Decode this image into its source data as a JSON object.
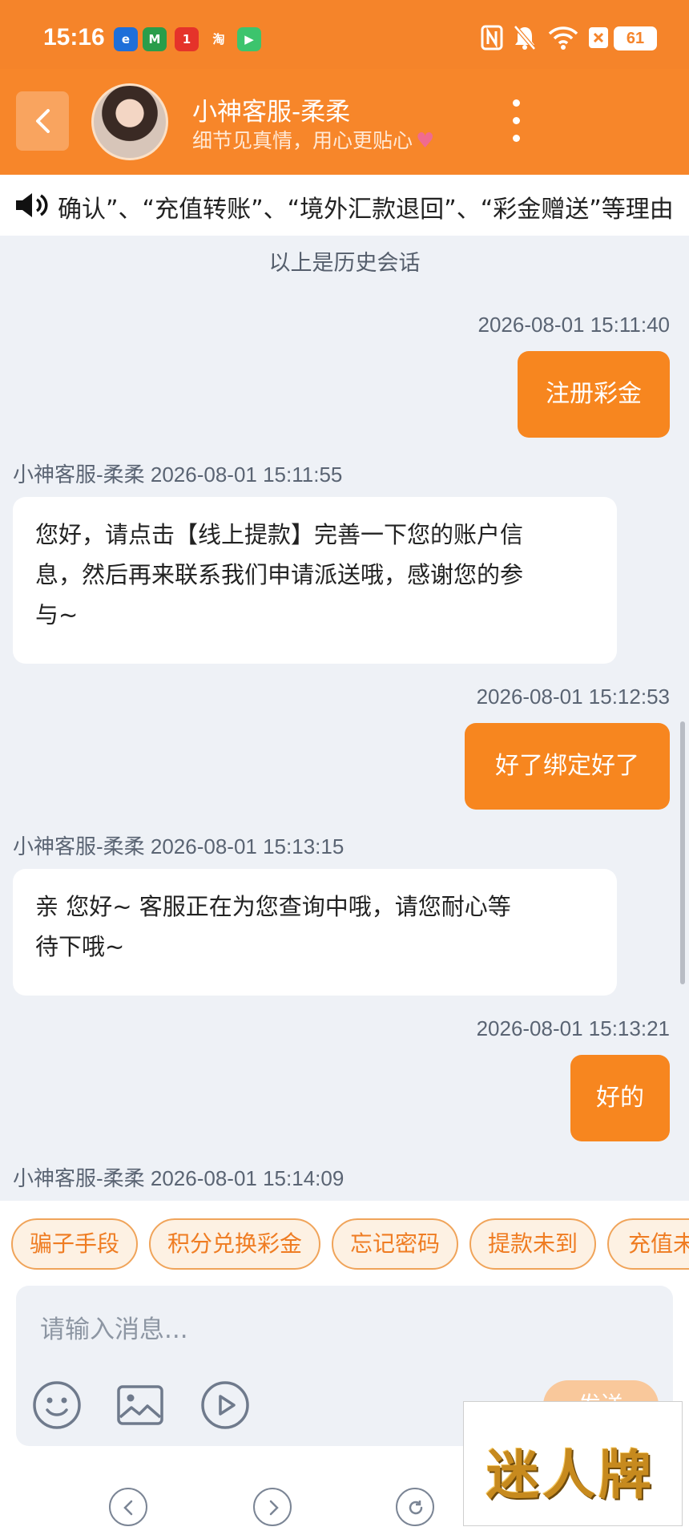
{
  "status_bar": {
    "time": "15:16",
    "apps": [
      {
        "icon": "browser-app-icon",
        "glyph": "e",
        "color": "#1e6fd9"
      },
      {
        "icon": "china-mobile-app-icon",
        "glyph": "M",
        "color": "#2a9d4a"
      },
      {
        "icon": "shopping-app-icon",
        "glyph": "1",
        "color": "#e5332a"
      },
      {
        "icon": "taobao-app-icon",
        "glyph": "淘",
        "color": "transparent"
      },
      {
        "icon": "video-app-icon",
        "glyph": "▶",
        "color": "#3cc46d"
      }
    ],
    "icons": [
      "nfc-icon",
      "mute-bell-icon",
      "wifi-icon",
      "sim-off-icon"
    ],
    "battery": "61"
  },
  "header": {
    "title": "小神客服-柔柔",
    "subtitle": "细节见真情，用心更贴心",
    "back_icon": "chevron-left-icon",
    "more_icon": "more-vertical-icon",
    "colors": {
      "brand": "#f7862a",
      "bubble_out": "#f7861f",
      "chip_text": "#ef7c22"
    }
  },
  "notice": {
    "icon": "speaker-icon",
    "text": "确认”、“充值转账”、“境外汇款退回”、“彩金赠送”等理由"
  },
  "chat": {
    "history_note": "以上是历史会话",
    "messages": [
      {
        "kind": "out",
        "time": "2026-08-01 15:11:40",
        "text": "注册彩金"
      },
      {
        "kind": "in",
        "meta": "小神客服-柔柔 2026-08-01 15:11:55",
        "lines": [
          "您好，请点击【线上提款】完善一下您的账户信",
          "息，然后再来联系我们申请派送哦，感谢您的参",
          "与~"
        ]
      },
      {
        "kind": "out",
        "time": "2026-08-01 15:12:53",
        "text": "好了绑定好了"
      },
      {
        "kind": "in",
        "meta": "小神客服-柔柔 2026-08-01 15:13:15",
        "lines": [
          "亲 您好~ 客服正在为您查询中哦，请您耐心等",
          "待下哦~"
        ]
      },
      {
        "kind": "out",
        "time": "2026-08-01 15:13:21",
        "text": "好的"
      },
      {
        "kind": "meta",
        "meta": "小神客服-柔柔 2026-08-01 15:14:09"
      }
    ]
  },
  "quick_replies": [
    "骗子手段",
    "积分兑换彩金",
    "忘记密码",
    "提款未到",
    "充值未"
  ],
  "composer": {
    "placeholder": "请输入消息...",
    "value": "",
    "tools": [
      "emoji-icon",
      "image-icon",
      "play-icon"
    ],
    "send_label": "发送"
  },
  "bottom_nav": [
    "back-nav-icon",
    "forward-nav-icon",
    "refresh-icon"
  ],
  "watermark": "迷人牌"
}
